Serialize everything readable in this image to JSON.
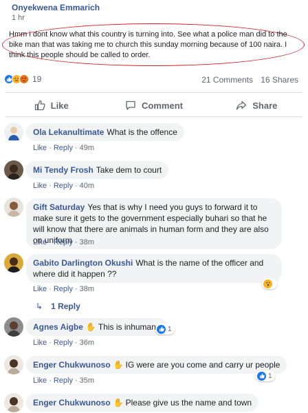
{
  "post": {
    "author": "Onyekwena Emmarich",
    "time": "1 hr",
    "text": "Hmm i dont know what this country is turning into. See what a police man did to the bike man that was taking me to church this sunday morning because of 100 naira. I think this people should be called to order."
  },
  "stats": {
    "reaction_count": "19",
    "comments": "21 Comments",
    "shares": "16 Shares"
  },
  "actions": {
    "like": "Like",
    "comment": "Comment",
    "share": "Share"
  },
  "comments": [
    {
      "name": "Ola Lekanultimate",
      "text": "What is the offence",
      "like": "Like",
      "reply": "Reply",
      "time": "49m"
    },
    {
      "name": "Mi Tendy Frosh",
      "text": "Take dem to court",
      "like": "Like",
      "reply": "Reply",
      "time": "40m"
    },
    {
      "name": "Gift Saturday",
      "text": "Yes that is why I need you guys to forward it to make sure it gets to the government especially buhari so that he will know that there are animals in human form and they are also on uniform",
      "like": "Like",
      "reply": "Reply",
      "time": "38m"
    },
    {
      "name": "Gabito Darlington Okushi",
      "text": "What is the name of the officer and where did it happen ??",
      "like": "Like",
      "reply": "Reply",
      "time": "38m",
      "replies": "1 Reply"
    },
    {
      "name": "Agnes Aigbe",
      "text": "This is inhumane",
      "like": "Like",
      "reply": "Reply",
      "time": "36m",
      "badge": "1"
    },
    {
      "name": "Enger Chukwunoso",
      "text": "IG were are you come and carry ur people",
      "like": "Like",
      "reply": "Reply",
      "time": "35m",
      "badge": "1"
    },
    {
      "name": "Enger Chukwunoso",
      "text": "Please give us the name and town"
    }
  ],
  "colors": {
    "link": "#385898",
    "meta": "#606770",
    "bubble": "#f2f3f5",
    "highlight_oval": "#d0222b",
    "like_blue": "#1877f2"
  }
}
